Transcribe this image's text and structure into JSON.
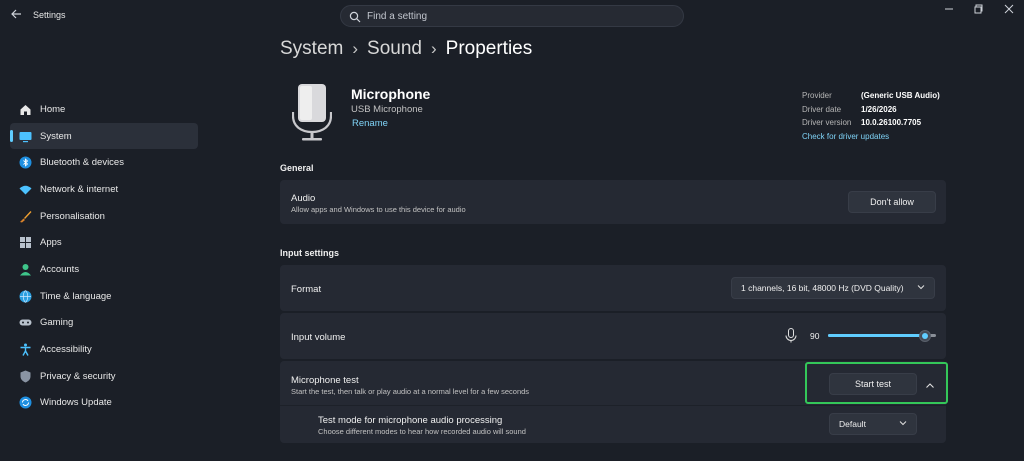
{
  "app": {
    "title": "Settings"
  },
  "search": {
    "placeholder": "Find a setting"
  },
  "breadcrumb": {
    "root": "System",
    "middle": "Sound",
    "current": "Properties"
  },
  "sidebar": {
    "items": [
      {
        "label": "Home",
        "icon": "home-icon"
      },
      {
        "label": "System",
        "icon": "system-icon",
        "active": true
      },
      {
        "label": "Bluetooth & devices",
        "icon": "bluetooth-icon"
      },
      {
        "label": "Network & internet",
        "icon": "wifi-icon"
      },
      {
        "label": "Personalisation",
        "icon": "brush-icon"
      },
      {
        "label": "Apps",
        "icon": "apps-icon"
      },
      {
        "label": "Accounts",
        "icon": "accounts-icon"
      },
      {
        "label": "Time & language",
        "icon": "globe-icon"
      },
      {
        "label": "Gaming",
        "icon": "gamepad-icon"
      },
      {
        "label": "Accessibility",
        "icon": "accessibility-icon"
      },
      {
        "label": "Privacy & security",
        "icon": "shield-icon"
      },
      {
        "label": "Windows Update",
        "icon": "update-icon"
      }
    ]
  },
  "device": {
    "name": "Microphone",
    "type": "USB Microphone",
    "rename": "Rename"
  },
  "driver": {
    "provider_label": "Provider",
    "provider": "(Generic USB Audio)",
    "date_label": "Driver date",
    "date": "1/26/2026",
    "version_label": "Driver version",
    "version": "10.0.26100.7705",
    "update_link": "Check for driver updates"
  },
  "general": {
    "title": "General",
    "audio": {
      "title": "Audio",
      "desc": "Allow apps and Windows to use this device for audio",
      "button": "Don't allow"
    }
  },
  "input": {
    "title": "Input settings",
    "format": {
      "title": "Format",
      "value": "1 channels, 16 bit, 48000 Hz (DVD Quality)"
    },
    "volume": {
      "title": "Input volume",
      "value": "90",
      "level": 90
    },
    "test": {
      "title": "Microphone test",
      "desc": "Start the test, then talk or play audio at a normal level for a few seconds",
      "button": "Start test"
    },
    "test_mode": {
      "title": "Test mode for microphone audio processing",
      "desc": "Choose different modes to hear how recorded audio will sound",
      "value": "Default"
    }
  },
  "colors": {
    "accent": "#60cdff",
    "highlight": "#34c759",
    "background": "#1b1f27",
    "card": "#252933"
  }
}
